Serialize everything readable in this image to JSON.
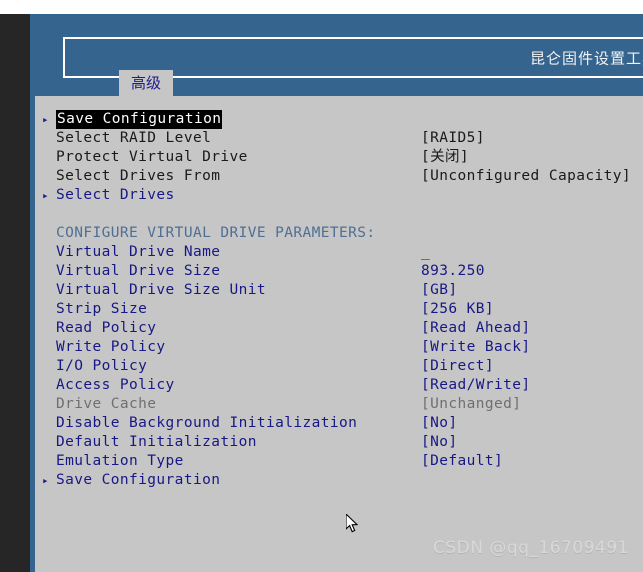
{
  "window": {
    "title": "昆仑固件设置工具",
    "watermark": "CSDN @qq_16709491"
  },
  "tabs": [
    {
      "label": "高级",
      "active": true
    }
  ],
  "colors": {
    "header_blue": "#35648f",
    "panel_gray": "#c6c6c6",
    "text_blue": "#181885",
    "text_dark": "#1a1a1a",
    "text_disabled": "#6f6f6f",
    "section_header": "#4f6f94",
    "selection_bg": "#000000",
    "selection_fg": "#ffffff",
    "left_strip": "#262626"
  },
  "icons": {
    "submenu_arrow": "▸",
    "mouse_pointer": "pointer-arrow"
  },
  "menu": {
    "rows": [
      {
        "arrow": "▸",
        "label": "Save Configuration",
        "value": "",
        "label_style": "sel",
        "value_style": "dark"
      },
      {
        "arrow": "",
        "label": "Select RAID Level",
        "value": "[RAID5]",
        "label_style": "dark",
        "value_style": "dark"
      },
      {
        "arrow": "",
        "label": "Protect Virtual Drive",
        "value": "[关闭]",
        "label_style": "dark",
        "value_style": "dark"
      },
      {
        "arrow": "",
        "label": "Select Drives From",
        "value": "[Unconfigured Capacity]",
        "label_style": "dark",
        "value_style": "dark"
      },
      {
        "arrow": "▸",
        "label": "Select Drives",
        "value": "",
        "label_style": "blue",
        "value_style": "blue"
      },
      {
        "arrow": "",
        "label": "",
        "value": "",
        "label_style": "blue",
        "value_style": "blue",
        "spacer": true
      },
      {
        "arrow": "",
        "label": "CONFIGURE VIRTUAL DRIVE PARAMETERS:",
        "value": "",
        "label_style": "hdr",
        "value_style": "hdr"
      },
      {
        "arrow": "",
        "label": "Virtual Drive Name",
        "value": "_",
        "label_style": "blue",
        "value_style": "blue"
      },
      {
        "arrow": "",
        "label": "Virtual Drive Size",
        "value": "893.250",
        "label_style": "blue",
        "value_style": "blue"
      },
      {
        "arrow": "",
        "label": "Virtual Drive Size Unit",
        "value": "[GB]",
        "label_style": "blue",
        "value_style": "blue"
      },
      {
        "arrow": "",
        "label": "Strip Size",
        "value": "[256 KB]",
        "label_style": "blue",
        "value_style": "blue"
      },
      {
        "arrow": "",
        "label": "Read Policy",
        "value": "[Read Ahead]",
        "label_style": "blue",
        "value_style": "blue"
      },
      {
        "arrow": "",
        "label": "Write Policy",
        "value": "[Write Back]",
        "label_style": "blue",
        "value_style": "blue"
      },
      {
        "arrow": "",
        "label": "I/O Policy",
        "value": "[Direct]",
        "label_style": "blue",
        "value_style": "blue"
      },
      {
        "arrow": "",
        "label": "Access Policy",
        "value": "[Read/Write]",
        "label_style": "blue",
        "value_style": "blue"
      },
      {
        "arrow": "",
        "label": "Drive Cache",
        "value": "[Unchanged]",
        "label_style": "gray",
        "value_style": "gray"
      },
      {
        "arrow": "",
        "label": "Disable Background Initialization",
        "value": "[No]",
        "label_style": "blue",
        "value_style": "blue"
      },
      {
        "arrow": "",
        "label": "Default Initialization",
        "value": "[No]",
        "label_style": "blue",
        "value_style": "blue"
      },
      {
        "arrow": "",
        "label": "Emulation Type",
        "value": "[Default]",
        "label_style": "blue",
        "value_style": "blue"
      },
      {
        "arrow": "▸",
        "label": "Save Configuration",
        "value": "",
        "label_style": "blue",
        "value_style": "blue"
      }
    ]
  }
}
